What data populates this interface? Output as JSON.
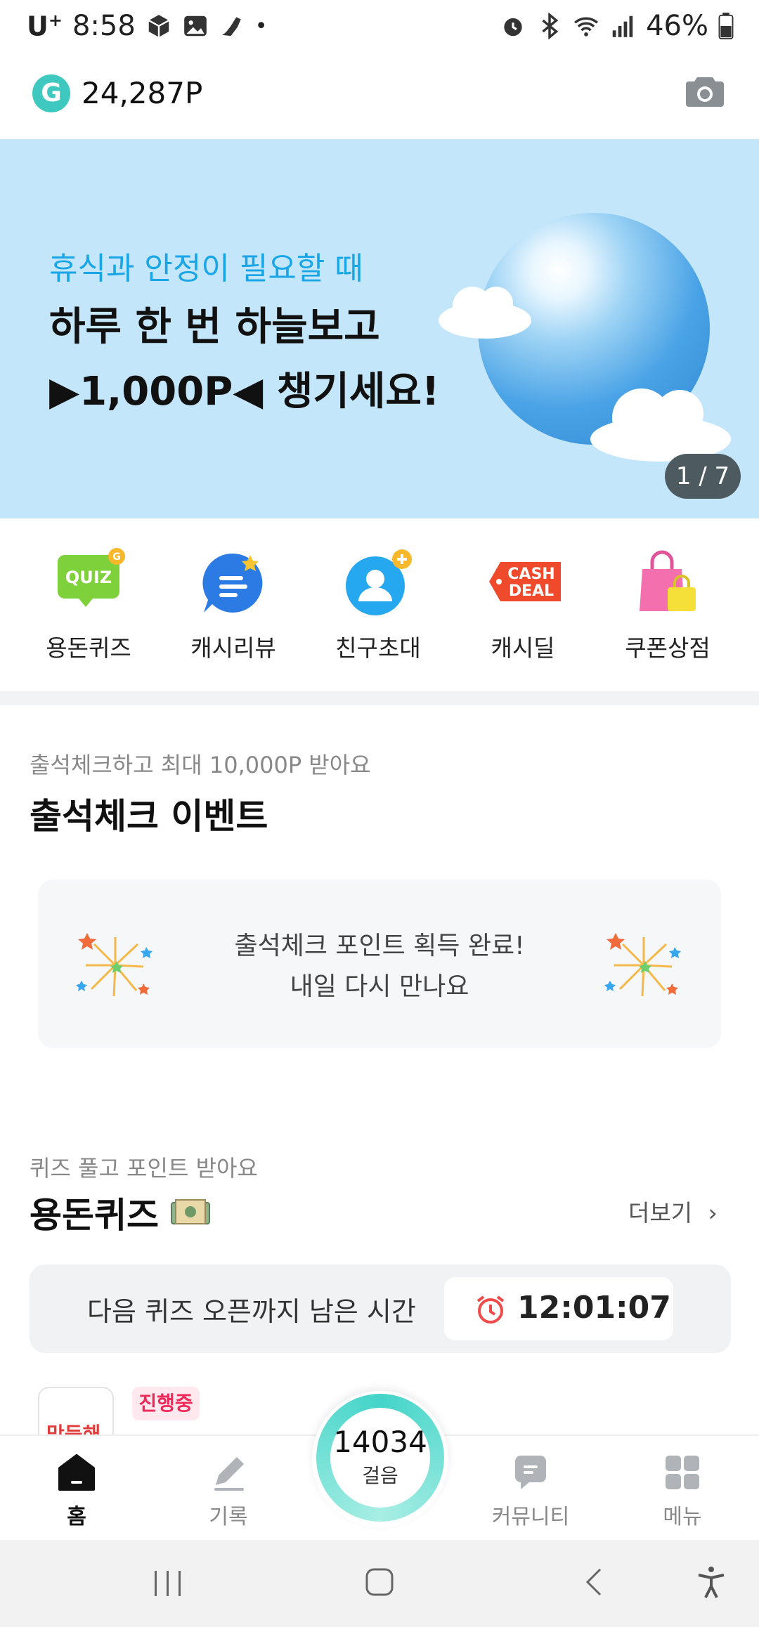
{
  "status_bar": {
    "carrier": "U",
    "carrier_plus": "+",
    "time": "8:58",
    "battery": "46%"
  },
  "header": {
    "coin_letter": "G",
    "points": "24,287P"
  },
  "banner": {
    "subtitle": "휴식과 안정이 필요할 때",
    "title_line1": "하루 한 번 하늘보고",
    "title_line2": "▶1,000P◀ 챙기세요!",
    "pager": "1 / 7"
  },
  "quick_menu": [
    {
      "label": "용돈퀴즈",
      "icon": "quiz-icon"
    },
    {
      "label": "캐시리뷰",
      "icon": "review-icon"
    },
    {
      "label": "친구초대",
      "icon": "invite-friend-icon"
    },
    {
      "label": "캐시딜",
      "icon": "cash-deal-icon"
    },
    {
      "label": "쿠폰상점",
      "icon": "coupon-shop-icon"
    }
  ],
  "quiz_icon_text": "QUIZ",
  "quiz_badge_letter": "G",
  "cashdeal_text_1": "CASH",
  "cashdeal_text_2": "DEAL",
  "attendance": {
    "subtitle": "출석체크하고 최대 10,000P 받아요",
    "title": "출석체크 이벤트",
    "message_line1": "출석체크 포인트 획득 완료!",
    "message_line2": "내일 다시 만나요"
  },
  "quiz_section": {
    "subtitle": "퀴즈 풀고 포인트 받아요",
    "title": "용돈퀴즈",
    "more": "더보기",
    "timer_label": "다음 퀴즈 오픈까지 남은 시간",
    "timer_value": "12:01:07",
    "item_brand": "맛둥해",
    "item_status": "진행중"
  },
  "bottom_nav": {
    "home": "홈",
    "record": "기록",
    "steps_value": "14034",
    "steps_label": "걸음",
    "community": "커뮤니티",
    "menu": "메뉴"
  },
  "colors": {
    "accent": "#3ec8c0",
    "banner_bg": "#c4e6fa",
    "banner_sub": "#1aa6e6",
    "badge": "#ee2a5a"
  }
}
